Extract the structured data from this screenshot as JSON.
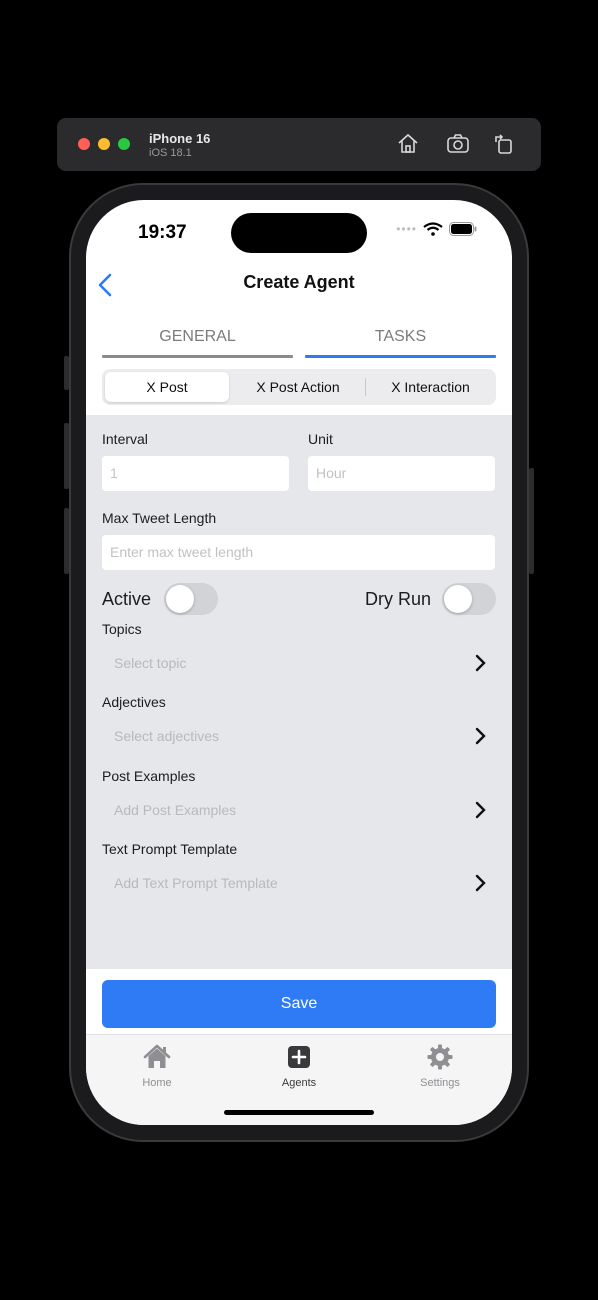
{
  "simulator": {
    "device_name": "iPhone 16",
    "os_version": "iOS 18.1"
  },
  "status_bar": {
    "time": "19:37"
  },
  "nav": {
    "title": "Create Agent"
  },
  "tabs": [
    {
      "label": "GENERAL"
    },
    {
      "label": "TASKS"
    }
  ],
  "segments": [
    {
      "label": "X Post"
    },
    {
      "label": "X Post Action"
    },
    {
      "label": "X Interaction"
    }
  ],
  "form": {
    "interval": {
      "label": "Interval",
      "placeholder": "1"
    },
    "unit": {
      "label": "Unit",
      "placeholder": "Hour"
    },
    "max_tweet_length": {
      "label": "Max Tweet Length",
      "placeholder": "Enter max tweet length"
    },
    "active": {
      "label": "Active",
      "on": false
    },
    "dry_run": {
      "label": "Dry Run",
      "on": false
    },
    "topics": {
      "label": "Topics",
      "placeholder": "Select topic"
    },
    "adjectives": {
      "label": "Adjectives",
      "placeholder": "Select adjectives"
    },
    "post_examples": {
      "label": "Post Examples",
      "placeholder": "Add Post Examples"
    },
    "text_prompt_template": {
      "label": "Text Prompt Template",
      "placeholder": "Add Text Prompt Template"
    }
  },
  "save_label": "Save",
  "tabbar": [
    {
      "label": "Home",
      "icon": "house-icon"
    },
    {
      "label": "Agents",
      "icon": "plus-square-icon"
    },
    {
      "label": "Settings",
      "icon": "gear-icon"
    }
  ],
  "colors": {
    "accent": "#2f7bf5",
    "form_background": "#e6e7ea"
  }
}
